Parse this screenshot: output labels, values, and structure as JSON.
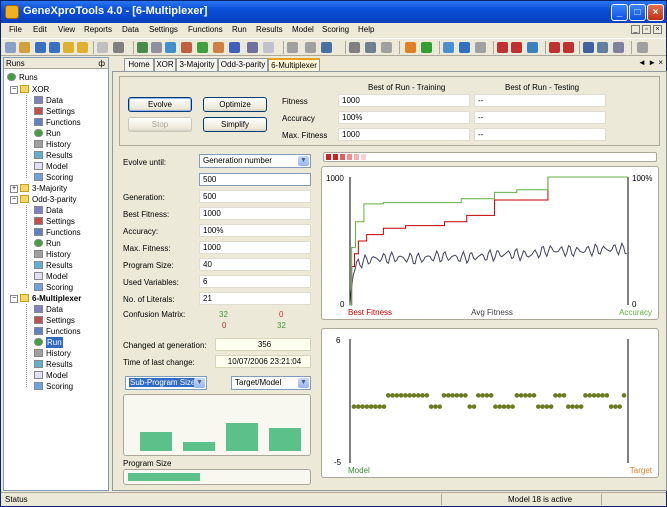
{
  "window": {
    "title": "GeneXproTools 4.0 - [6-Multiplexer]"
  },
  "menu": [
    "File",
    "Edit",
    "View",
    "Reports",
    "Data",
    "Settings",
    "Functions",
    "Run",
    "Results",
    "Model",
    "Scoring",
    "Help"
  ],
  "runs_panel": {
    "header": "Runs",
    "pin": "ф",
    "root": "Runs",
    "tree": [
      {
        "label": "XOR",
        "items": [
          "Data",
          "Settings",
          "Functions",
          "Run",
          "History",
          "Results",
          "Model",
          "Scoring"
        ]
      },
      {
        "label": "3-Majority",
        "items": []
      },
      {
        "label": "Odd-3-parity",
        "items": [
          "Data",
          "Settings",
          "Functions",
          "Run",
          "History",
          "Results",
          "Model",
          "Scoring"
        ]
      },
      {
        "label": "6-Multiplexer",
        "items": [
          "Data",
          "Settings",
          "Functions",
          "Run",
          "History",
          "Results",
          "Model",
          "Scoring"
        ]
      }
    ]
  },
  "tabs": [
    "Home",
    "XOR",
    "3-Majority",
    "Odd-3-parity",
    "6-Multiplexer"
  ],
  "tab_nav": "◄ ► ×",
  "buttons": {
    "evolve": "Evolve",
    "optimize": "Optimize",
    "stop": "Stop",
    "simplify": "Simplify"
  },
  "best_of_run": {
    "training_header": "Best of Run - Training",
    "testing_header": "Best of Run - Testing",
    "rows": [
      {
        "label": "Fitness",
        "training": "1000",
        "testing": "--"
      },
      {
        "label": "Accuracy",
        "training": "100%",
        "testing": "--"
      },
      {
        "label": "Max. Fitness",
        "training": "1000",
        "testing": "--"
      }
    ]
  },
  "form": {
    "evolve_until_label": "Evolve until:",
    "evolve_until_value": "Generation number",
    "evolve_until_target": "500",
    "stats": [
      {
        "label": "Generation:",
        "value": "500"
      },
      {
        "label": "Best Fitness:",
        "value": "1000"
      },
      {
        "label": "Accuracy:",
        "value": "100%"
      },
      {
        "label": "Max. Fitness:",
        "value": "1000"
      },
      {
        "label": "Program Size:",
        "value": "40"
      },
      {
        "label": "Used Variables:",
        "value": "6"
      },
      {
        "label": "No. of Literals:",
        "value": "21"
      }
    ],
    "confusion_label": "Confusion Matrix:",
    "confusion": {
      "tp": "32",
      "fp": "0",
      "fn": "0",
      "tn": "32"
    },
    "changed_label": "Changed at generation:",
    "changed_value": "356",
    "time_label": "Time of last change:",
    "time_value": "10/07/2006 23:21:04",
    "subprog_combo": "Sub-Program Sizes",
    "target_combo": "Target/Model",
    "program_size_label": "Program Size",
    "subprog_sizes": [
      4,
      2,
      6,
      5
    ],
    "program_size_fill": 0.55
  },
  "chart_fitness": {
    "type": "line",
    "y_left_top": "1000",
    "y_left_bottom": "0",
    "y_right_top": "100%",
    "y_right_bottom": "0",
    "legend": [
      {
        "name": "Best Fitness",
        "color": "#c00000"
      },
      {
        "name": "Avg Fitness",
        "color": "#404040"
      },
      {
        "name": "Accuracy",
        "color": "#60b040"
      }
    ]
  },
  "chart_target": {
    "type": "scatter",
    "y_top": "6",
    "y_bottom": "-5",
    "legend_left": "Model",
    "legend_right": "Target",
    "colors": {
      "model": "#3a8a3a",
      "target": "#e08020",
      "points": "#6a7a20"
    }
  },
  "chart_data": [
    {
      "type": "line",
      "xlim": [
        0,
        500
      ],
      "ylim": [
        0,
        1000
      ],
      "series": [
        {
          "name": "Best Fitness",
          "x": [
            0,
            3,
            8,
            15,
            30,
            60,
            100,
            130,
            170,
            210,
            240,
            260,
            300,
            356,
            500
          ],
          "values": [
            0,
            300,
            400,
            500,
            550,
            600,
            620,
            620,
            650,
            700,
            700,
            820,
            820,
            1000,
            1000
          ]
        },
        {
          "name": "Avg Fitness",
          "x": [
            0,
            5,
            15,
            40,
            80,
            120,
            160,
            200,
            240,
            280,
            320,
            360,
            400,
            440,
            480,
            500
          ],
          "values": [
            0,
            250,
            330,
            360,
            370,
            360,
            380,
            370,
            380,
            400,
            390,
            430,
            420,
            430,
            440,
            430
          ]
        },
        {
          "name": "Accuracy",
          "x": [
            0,
            3,
            10,
            25,
            60,
            120,
            200,
            260,
            300,
            356,
            500
          ],
          "values": [
            0,
            450,
            650,
            790,
            800,
            800,
            830,
            880,
            900,
            1000,
            1000
          ]
        }
      ]
    },
    {
      "type": "scatter",
      "ylim": [
        -5,
        6
      ],
      "series": [
        {
          "name": "Model",
          "values": [
            0,
            0,
            0,
            0,
            0,
            0,
            0,
            0,
            1,
            1,
            1,
            1,
            1,
            1,
            1,
            1,
            1,
            1,
            0,
            0,
            0,
            1,
            1,
            1,
            1,
            1,
            1,
            0,
            0,
            1,
            1,
            1,
            1,
            0,
            0,
            0,
            0,
            0,
            1,
            1,
            1,
            1,
            1,
            0,
            0,
            0,
            0,
            1,
            1,
            1,
            0,
            0,
            0,
            0,
            1,
            1,
            1,
            1,
            1,
            1,
            0,
            0,
            0,
            1
          ]
        }
      ]
    }
  ],
  "status": {
    "left": "Status",
    "right": "Model 18 is active"
  }
}
